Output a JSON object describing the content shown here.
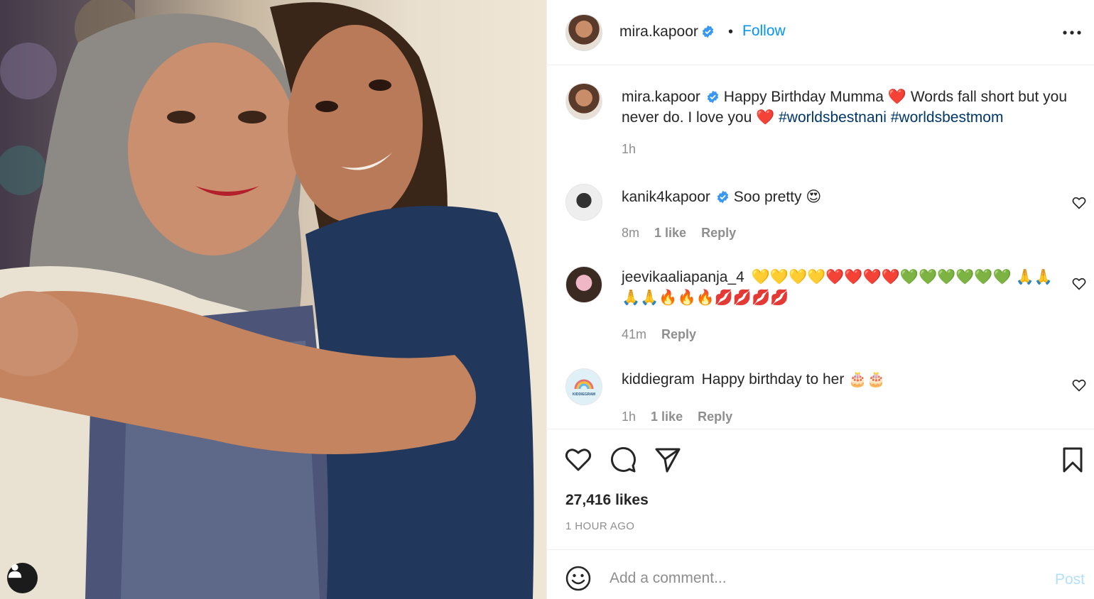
{
  "post": {
    "username": "mira.kapoor",
    "follow_label": "Follow",
    "separator": "•"
  },
  "caption": {
    "username": "mira.kapoor",
    "text_part1": "Happy Birthday Mumma",
    "heart1": "❤️",
    "text_part2": "Words fall short but you never do. I love you",
    "heart2": "❤️",
    "hashtag1": "#worldsbestnani",
    "hashtag2": "#worldsbestmom",
    "time": "1h"
  },
  "comments": [
    {
      "username": "kanik4kapoor",
      "verified": true,
      "text": "Soo pretty 😍",
      "time": "8m",
      "likes": "1 like",
      "reply": "Reply"
    },
    {
      "username": "jeevikaaliapanja_4",
      "verified": false,
      "text": "💛💛💛💛❤️❤️❤️❤️💚💚💚💚💚💚 🙏🙏🙏🙏🔥🔥🔥💋💋💋💋",
      "time": "41m",
      "reply": "Reply"
    },
    {
      "username": "kiddiegram",
      "verified": false,
      "text": "Happy birthday to her 🎂🎂",
      "time": "1h",
      "likes": "1 like",
      "reply": "Reply",
      "avatar_text": "KIDDIEGRAM"
    }
  ],
  "stats": {
    "likes": "27,416 likes",
    "posted": "1 HOUR AGO"
  },
  "composer": {
    "placeholder": "Add a comment...",
    "post_label": "Post"
  },
  "colors": {
    "link_blue": "#0095f6",
    "hashtag": "#00376b",
    "muted": "#8e8e8e",
    "post_disabled": "#b2dffc"
  },
  "icons": [
    "verified-badge-icon",
    "more-options-icon",
    "heart-icon",
    "comment-icon",
    "share-icon",
    "bookmark-icon",
    "emoji-icon",
    "user-tag-icon"
  ]
}
